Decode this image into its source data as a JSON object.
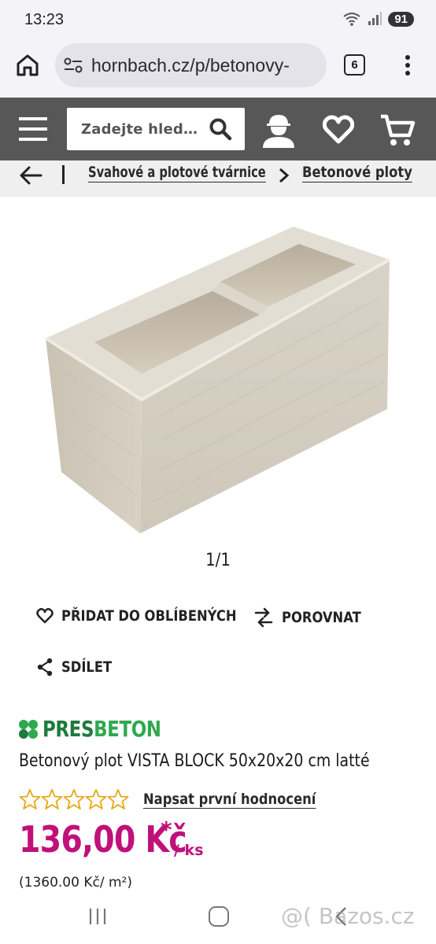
{
  "status_bar": {
    "time": "13:23",
    "battery": "91",
    "icons": [
      "wifi-icon",
      "signal-icon"
    ]
  },
  "browser": {
    "url": "hornbach.cz/p/betonovy-",
    "tab_count": "6",
    "icons": [
      "home-icon",
      "site-settings-icon",
      "more-vert-icon"
    ]
  },
  "header": {
    "search_placeholder": "Zadejte hled…",
    "icons": [
      "menu-icon",
      "search-icon",
      "account-icon",
      "heart-icon",
      "cart-icon"
    ],
    "background": "#575757"
  },
  "breadcrumb": {
    "items": [
      {
        "label": "Svahové a plotové tvárnice"
      },
      {
        "label": "Betonové ploty"
      }
    ]
  },
  "gallery": {
    "counter": "1/1"
  },
  "actions": {
    "favorite": "PŘIDAT DO OBLÍBENÝCH",
    "compare": "POROVNAT",
    "share": "SDÍLET"
  },
  "product": {
    "brand_part1": "PRES",
    "brand_part2": "BETON",
    "title": "Betonový plot VISTA BLOCK 50x20x20 cm latté",
    "rating_stars": 0,
    "rating_max": 5,
    "review_link": "Napsat první hodnocení",
    "price": "136,00 Kč",
    "price_asterisk": "*",
    "price_unit": "/ ks",
    "unit_price": "(1360.00 Kč/ m²)",
    "price_color": "#c0117a",
    "star_color": "#e6a817",
    "brand_colors": [
      "#1f7a3c",
      "#2fa84f"
    ]
  },
  "nav_bar": {
    "watermark": "@( Bazos.cz"
  }
}
